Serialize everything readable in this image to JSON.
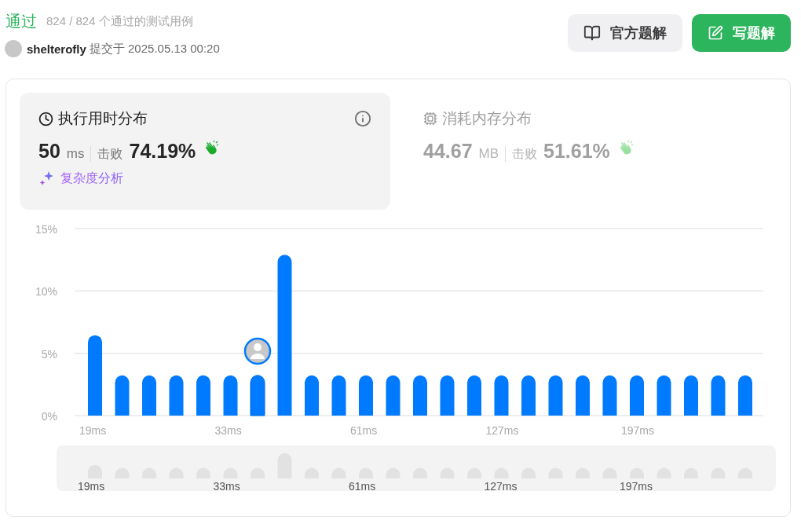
{
  "header": {
    "status": "通过",
    "tests": "824 / 824 个通过的测试用例",
    "user": "shelterofly",
    "submitted": "提交于 2025.05.13 00:20"
  },
  "buttons": [
    {
      "kind": "secondary",
      "label": "官方题解"
    },
    {
      "kind": "primary",
      "label": "写题解"
    }
  ],
  "panels": [
    {
      "kind": "runtime",
      "selected": true,
      "title": "执行用时分布",
      "value": "50",
      "unit": "ms",
      "beats_label": "击败",
      "beats": "74.19%",
      "link": "复杂度分析"
    },
    {
      "kind": "memory",
      "selected": false,
      "title": "消耗内存分布",
      "value": "44.67",
      "unit": "MB",
      "beats_label": "击败",
      "beats": "51.61%"
    }
  ],
  "chart": {
    "bars_selected": [
      false,
      false,
      false,
      false,
      false,
      false,
      true,
      false,
      false,
      false,
      false,
      false,
      false,
      false,
      false,
      false,
      false,
      false,
      false,
      false,
      false,
      false,
      false,
      false,
      false
    ],
    "chart_data": {
      "type": "bar",
      "categories": [
        "19ms",
        null,
        null,
        null,
        null,
        "33ms",
        null,
        null,
        null,
        null,
        "61ms",
        null,
        null,
        null,
        null,
        "127ms",
        null,
        null,
        null,
        null,
        "197ms",
        null,
        null,
        null,
        null
      ],
      "ylim": [
        0,
        15
      ],
      "yticks": [
        {
          "value": 0,
          "label": "0%"
        },
        {
          "value": 5,
          "label": "5%"
        },
        {
          "value": 10,
          "label": "10%"
        },
        {
          "value": 15,
          "label": "15%"
        }
      ],
      "series": [
        {
          "color": "#007aff",
          "values": [
            6.45,
            3.23,
            3.23,
            3.23,
            3.23,
            3.23,
            3.23,
            12.9,
            3.23,
            3.23,
            3.23,
            3.23,
            3.23,
            3.23,
            3.23,
            3.23,
            3.23,
            3.23,
            3.23,
            3.23,
            3.23,
            3.23,
            3.23,
            3.23,
            3.23
          ]
        }
      ]
    }
  },
  "overview": {
    "labels": [
      "19ms",
      "33ms",
      "61ms",
      "127ms",
      "197ms"
    ]
  }
}
